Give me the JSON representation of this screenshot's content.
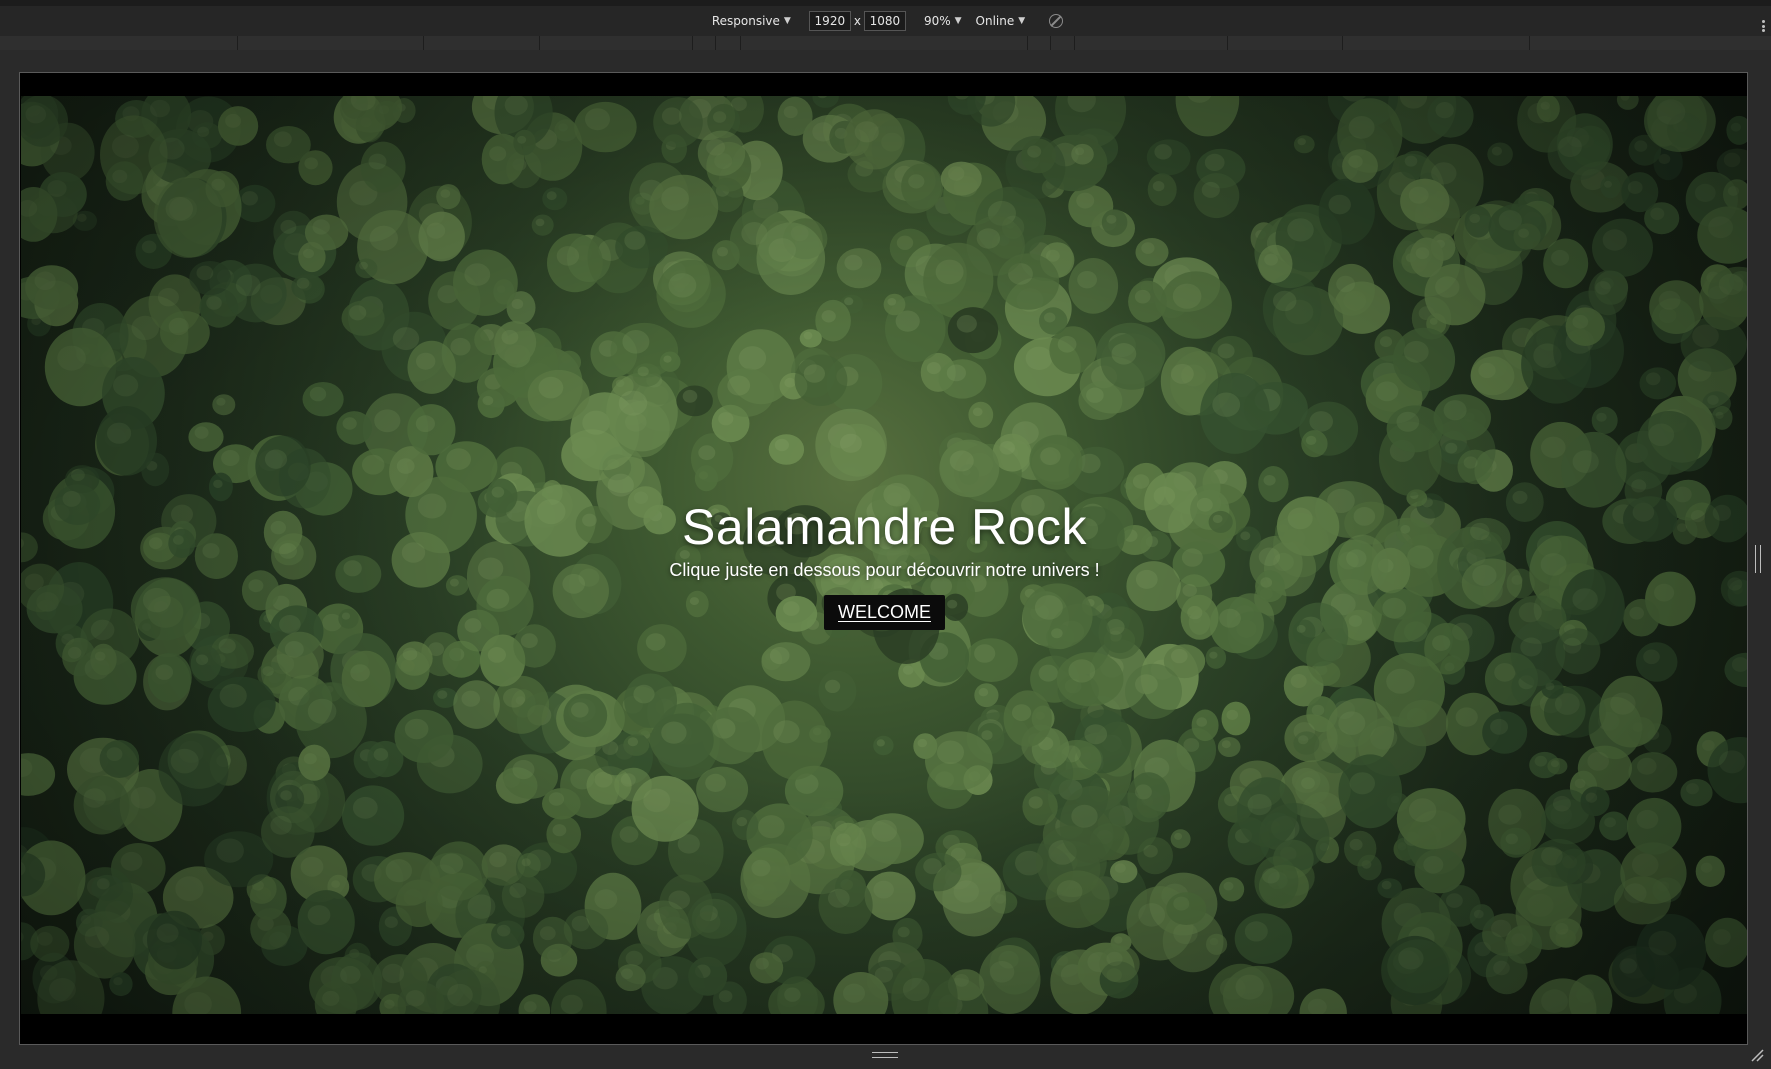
{
  "toolbar": {
    "device_label": "Responsive",
    "width_value": "1920",
    "height_value": "1080",
    "times_symbol": "x",
    "zoom_label": "90%",
    "network_label": "Online"
  },
  "hero": {
    "title": "Salamandre Rock",
    "subtitle": "Clique juste en dessous pour découvrir notre univers !",
    "button_label": "WELCOME"
  },
  "colors": {
    "devtools_bg": "#2a2a2a",
    "button_bg": "#0b0b0b",
    "forest_dark": "#1d2c1b",
    "forest_light": "#58703f"
  }
}
